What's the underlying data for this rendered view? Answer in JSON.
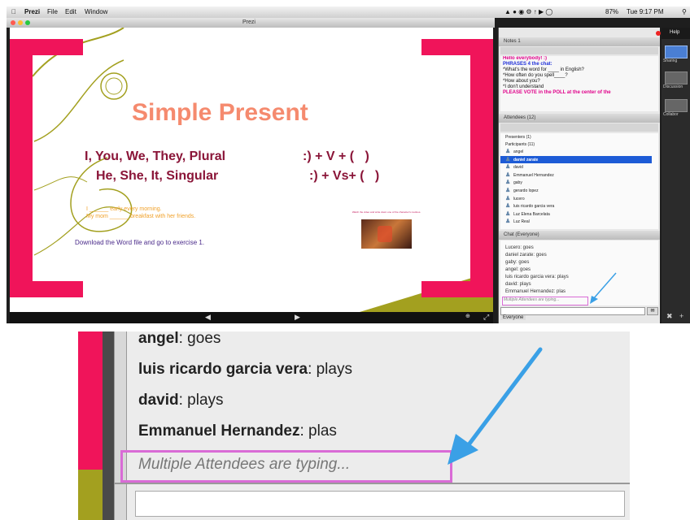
{
  "menubar": {
    "apple": "",
    "app": "Prezi",
    "menus": [
      "File",
      "Edit",
      "Window"
    ],
    "battery": "87%",
    "clock": "Tue 9:17 PM"
  },
  "window_title": "Prezi",
  "slide": {
    "title": "Simple Present",
    "line1_subjects": "I, You, We, They, Plural",
    "line1_formula": ":) + V + (   )",
    "line2_subjects": "He, She, It, Singular",
    "line2_formula": ":) + Vs+ (   )",
    "ex1": "I ______ early every morning.",
    "ex2": "My mom ______ breakfast with her friends.",
    "download": "Download the Word file and go to exercise 1.",
    "caption": "Watch the video and write down one of the character's routines.",
    "zoom_label": ""
  },
  "notes": {
    "title": "Notes 1",
    "lines": [
      {
        "text": "Hello everybody! :)",
        "color": "#e0008a"
      },
      {
        "text": "PHRASES 4 the chat:",
        "color": "#1f2fd8"
      },
      {
        "text": "*What's the word for ____ in English?",
        "color": "#111111"
      },
      {
        "text": "*How often do you spell____?",
        "color": "#111111"
      },
      {
        "text": "*How about you?",
        "color": "#111111"
      },
      {
        "text": "*I don't understand",
        "color": "#111111"
      },
      {
        "text": "PLEASE VOTE in the POLL at the center of the",
        "color": "#e0008a"
      }
    ]
  },
  "attendees": {
    "title": "Attendees (12)",
    "presenters": "Presenters (1)",
    "participants": "Participants (11)",
    "names": [
      "angel",
      "daniel zarate",
      "david",
      "Emmanuel Hernandez",
      "gaby",
      "gerardo lopez",
      "lucero",
      "luis ricardo garcia vera",
      "Luz Elena Barcelata",
      "Luz Real"
    ],
    "selected_index": 1
  },
  "chat": {
    "title": "Chat (Everyone)",
    "messages": [
      "Lucero: goes",
      "daniel zarate: goes",
      "gaby: goes",
      "angel: goes",
      "luis ricardo garcia vera: plays",
      "david: plays",
      "Emmanuel Hernandez: plas"
    ],
    "typing": "Multiple Attendees are typing...",
    "recipient": "Everyone"
  },
  "side": {
    "help": "Help",
    "labels": [
      "Sharing",
      "Discussion",
      "Collabor"
    ]
  },
  "zoom": {
    "lines": [
      {
        "name": "angel",
        "text": ": goes"
      },
      {
        "name": "luis ricardo garcia vera",
        "text": ": plays"
      },
      {
        "name": "david",
        "text": ": plays"
      },
      {
        "name": "Emmanuel Hernandez",
        "text": ": plas"
      }
    ],
    "typing": "Multiple Attendees are typing..."
  },
  "colors": {
    "accent_pink": "#f0145a",
    "title_salmon": "#f58a6e",
    "formula_maroon": "#8a1538",
    "olive": "#a3a01f",
    "highlight_box": "#d96bd6",
    "arrow": "#3aa0e6"
  }
}
